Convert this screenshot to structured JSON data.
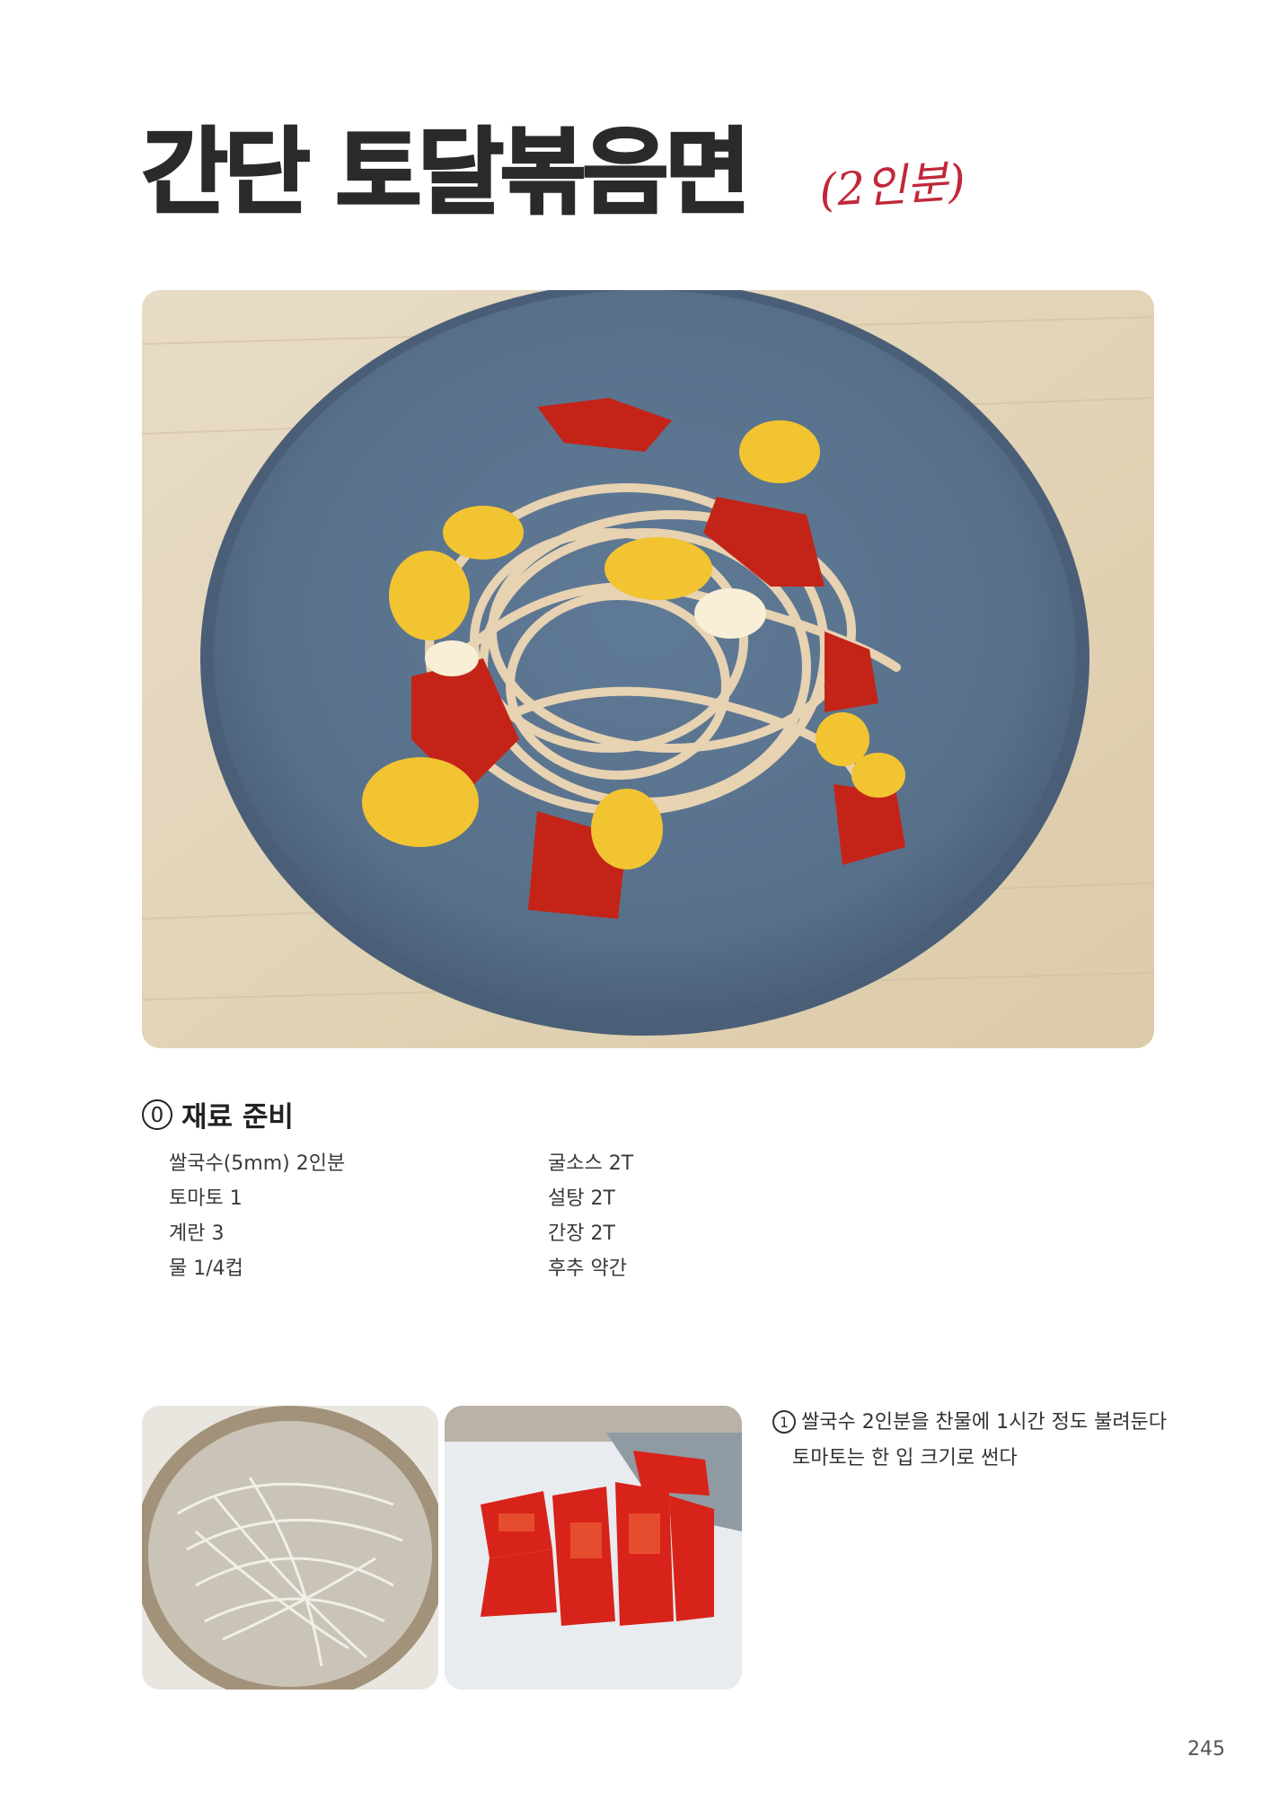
{
  "title": "간단 토달볶음면",
  "servings_note": "(2인분)",
  "section": {
    "number": "0",
    "heading": "재료 준비"
  },
  "ingredients_left": [
    "쌀국수(5mm) 2인분",
    "토마토 1",
    "계란 3",
    "물 1/4컵"
  ],
  "ingredients_right": [
    "굴소스 2T",
    "설탕 2T",
    "간장 2T",
    "후추 약간"
  ],
  "step1": {
    "number": "1",
    "line1": "쌀국수 2인분을 찬물에 1시간 정도 불려둔다",
    "line2": "토마토는 한 입 크기로 썬다"
  },
  "page_number": "245"
}
